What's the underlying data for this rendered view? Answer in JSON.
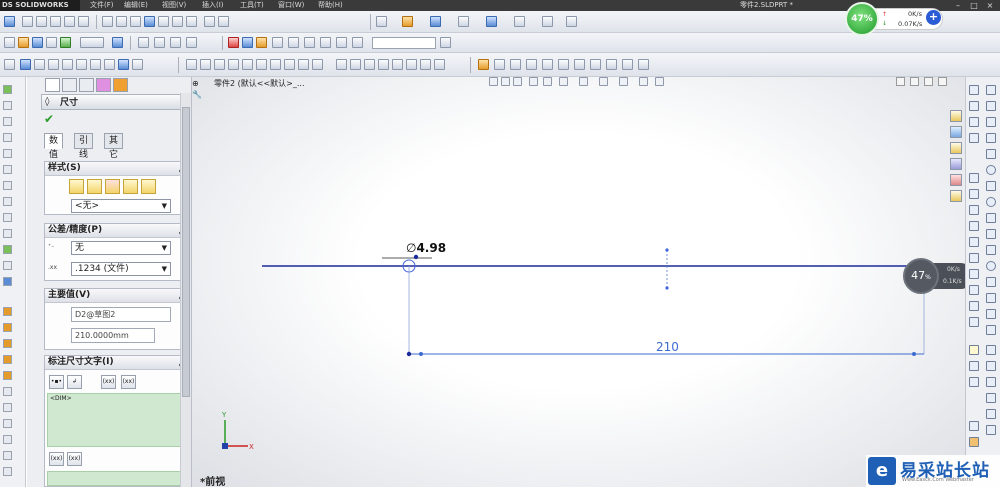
{
  "app": {
    "logo": "DS SOLIDWORKS",
    "menu": [
      "文件(F)",
      "编辑(E)",
      "视图(V)",
      "插入(I)",
      "工具(T)",
      "窗口(W)",
      "帮助(H)"
    ],
    "doc_title": "零件2.SLDPRT *"
  },
  "network_widget": {
    "percent": "47%",
    "upload": "0K/s",
    "download": "0.07K/s"
  },
  "property_manager": {
    "title": "尺寸",
    "help": "?",
    "tabs": [
      "数值",
      "引线",
      "其它"
    ],
    "style_group": {
      "header": "样式(S)",
      "select_value": "<无>"
    },
    "tolerance_group": {
      "header": "公差/精度(P)",
      "tolerance_type": "无",
      "precision": ".1234 (文件)"
    },
    "primary_value_group": {
      "header": "主要值(V)",
      "name": "D2@草图2",
      "value": "210.0000mm"
    },
    "dim_text_group": {
      "header": "标注尺寸文字(I)",
      "text": "<DIM>",
      "btn_xx_1": "(xx)",
      "btn_xx_2": "(xx)",
      "btn_xx_3": "(xx)",
      "btn_xx_4": "(xx)"
    }
  },
  "viewport": {
    "tree_text": "零件2 (默认<<默认>_...",
    "view_name": "*前视",
    "dim_diameter": "4.98",
    "diameter_symbol": "∅",
    "dim_length": "210",
    "axis_y": "Y",
    "axis_x": "X"
  },
  "overlay_widget": {
    "percent": "47",
    "unit": "%",
    "upload": "0K/s",
    "download": "0.1K/s"
  },
  "watermark": {
    "logo_char": "e",
    "text": "易采站长站",
    "sub": "Www.Easck.Com Webmaster"
  }
}
